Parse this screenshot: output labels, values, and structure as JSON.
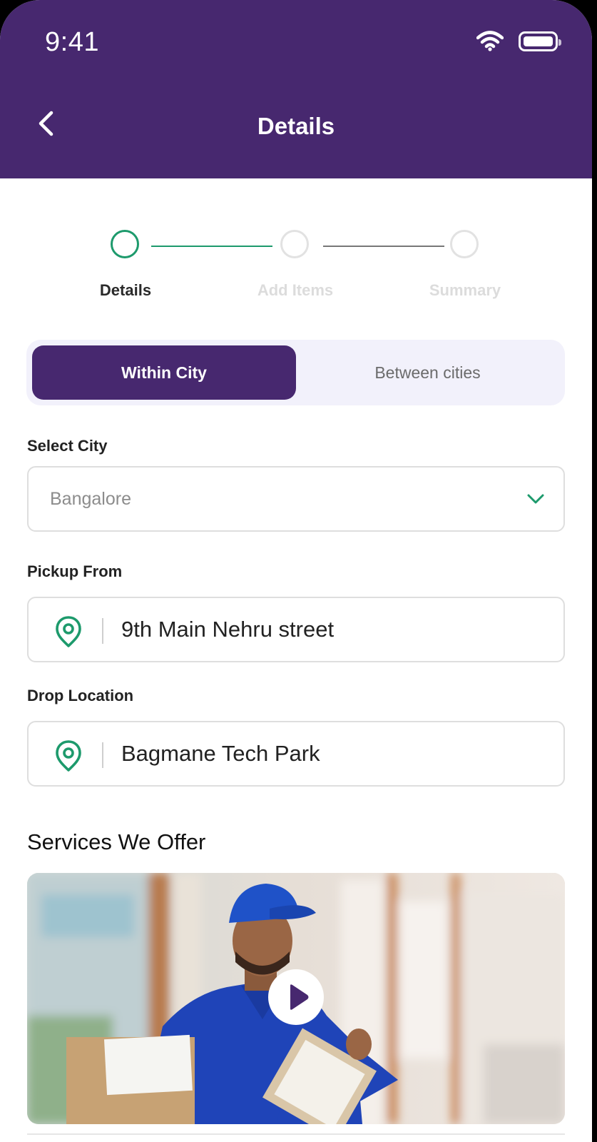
{
  "status_bar": {
    "time": "9:41"
  },
  "header": {
    "title": "Details"
  },
  "stepper": {
    "steps": [
      {
        "label": "Details",
        "state": "active"
      },
      {
        "label": "Add Items",
        "state": "inactive"
      },
      {
        "label": "Summary",
        "state": "inactive"
      }
    ]
  },
  "segment": {
    "active": "Within City",
    "inactive": "Between cities"
  },
  "form": {
    "city": {
      "label": "Select City",
      "value": "Bangalore"
    },
    "pickup": {
      "label": "Pickup From",
      "value": "9th Main Nehru street"
    },
    "drop": {
      "label": "Drop Location",
      "value": "Bagmane Tech Park"
    }
  },
  "services": {
    "title": "Services We Offer"
  },
  "colors": {
    "brand": "#47286f",
    "accent": "#1d9a6c",
    "segment_bg": "#f2f1fb"
  },
  "icons": [
    "back-chevron-icon",
    "wifi-icon",
    "battery-icon",
    "chevron-down-icon",
    "location-pin-icon",
    "play-icon"
  ]
}
